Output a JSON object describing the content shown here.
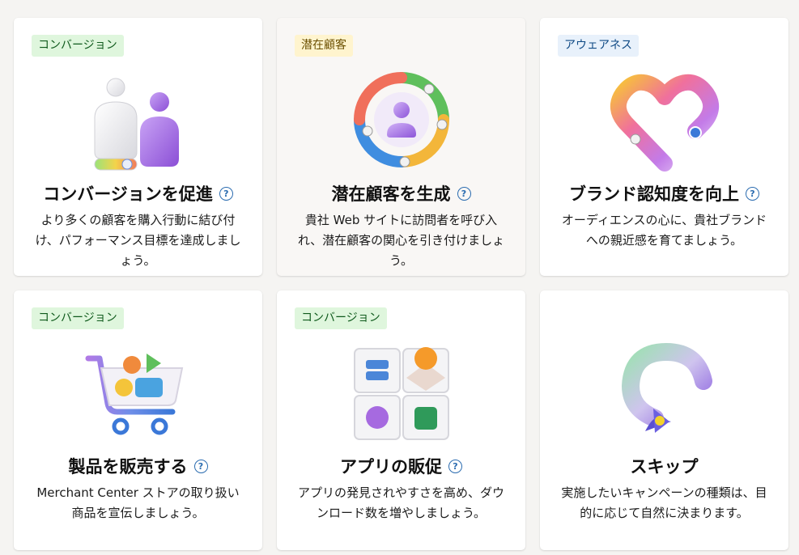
{
  "cards": [
    {
      "badge": "コンバージョン",
      "title": "コンバージョンを促進",
      "description": "より多くの顧客を購入行動に結び付け、パフォーマンス目標を達成しましょう。"
    },
    {
      "badge": "潜在顧客",
      "title": "潜在顧客を生成",
      "description": "貴社 Web サイトに訪問者を呼び入れ、潜在顧客の関心を引き付けましょう。"
    },
    {
      "badge": "アウェアネス",
      "title": "ブランド認知度を向上",
      "description": "オーディエンスの心に、貴社ブランドへの親近感を育てましょう。"
    },
    {
      "badge": "コンバージョン",
      "title": "製品を販売する",
      "description": "Merchant Center ストアの取り扱い商品を宣伝しましょう。"
    },
    {
      "badge": "コンバージョン",
      "title": "アプリの販促",
      "description": "アプリの発見されやすさを高め、ダウンロード数を増やしましょう。"
    },
    {
      "badge": "",
      "title": "スキップ",
      "description": "実施したいキャンペーンの種類は、目的に応じて自然に決まります。"
    }
  ],
  "icons": [
    "conversion-people-icon",
    "leads-cycle-icon",
    "awareness-heart-icon",
    "shopping-cart-icon",
    "app-tiles-icon",
    "skip-swirl-icon",
    "help-icon"
  ],
  "colors": {
    "badge_conversion_bg": "#dff6dd",
    "badge_leads_bg": "#fff4ce",
    "badge_awareness_bg": "#e8f1fb",
    "help_icon": "#2b6cb0"
  }
}
